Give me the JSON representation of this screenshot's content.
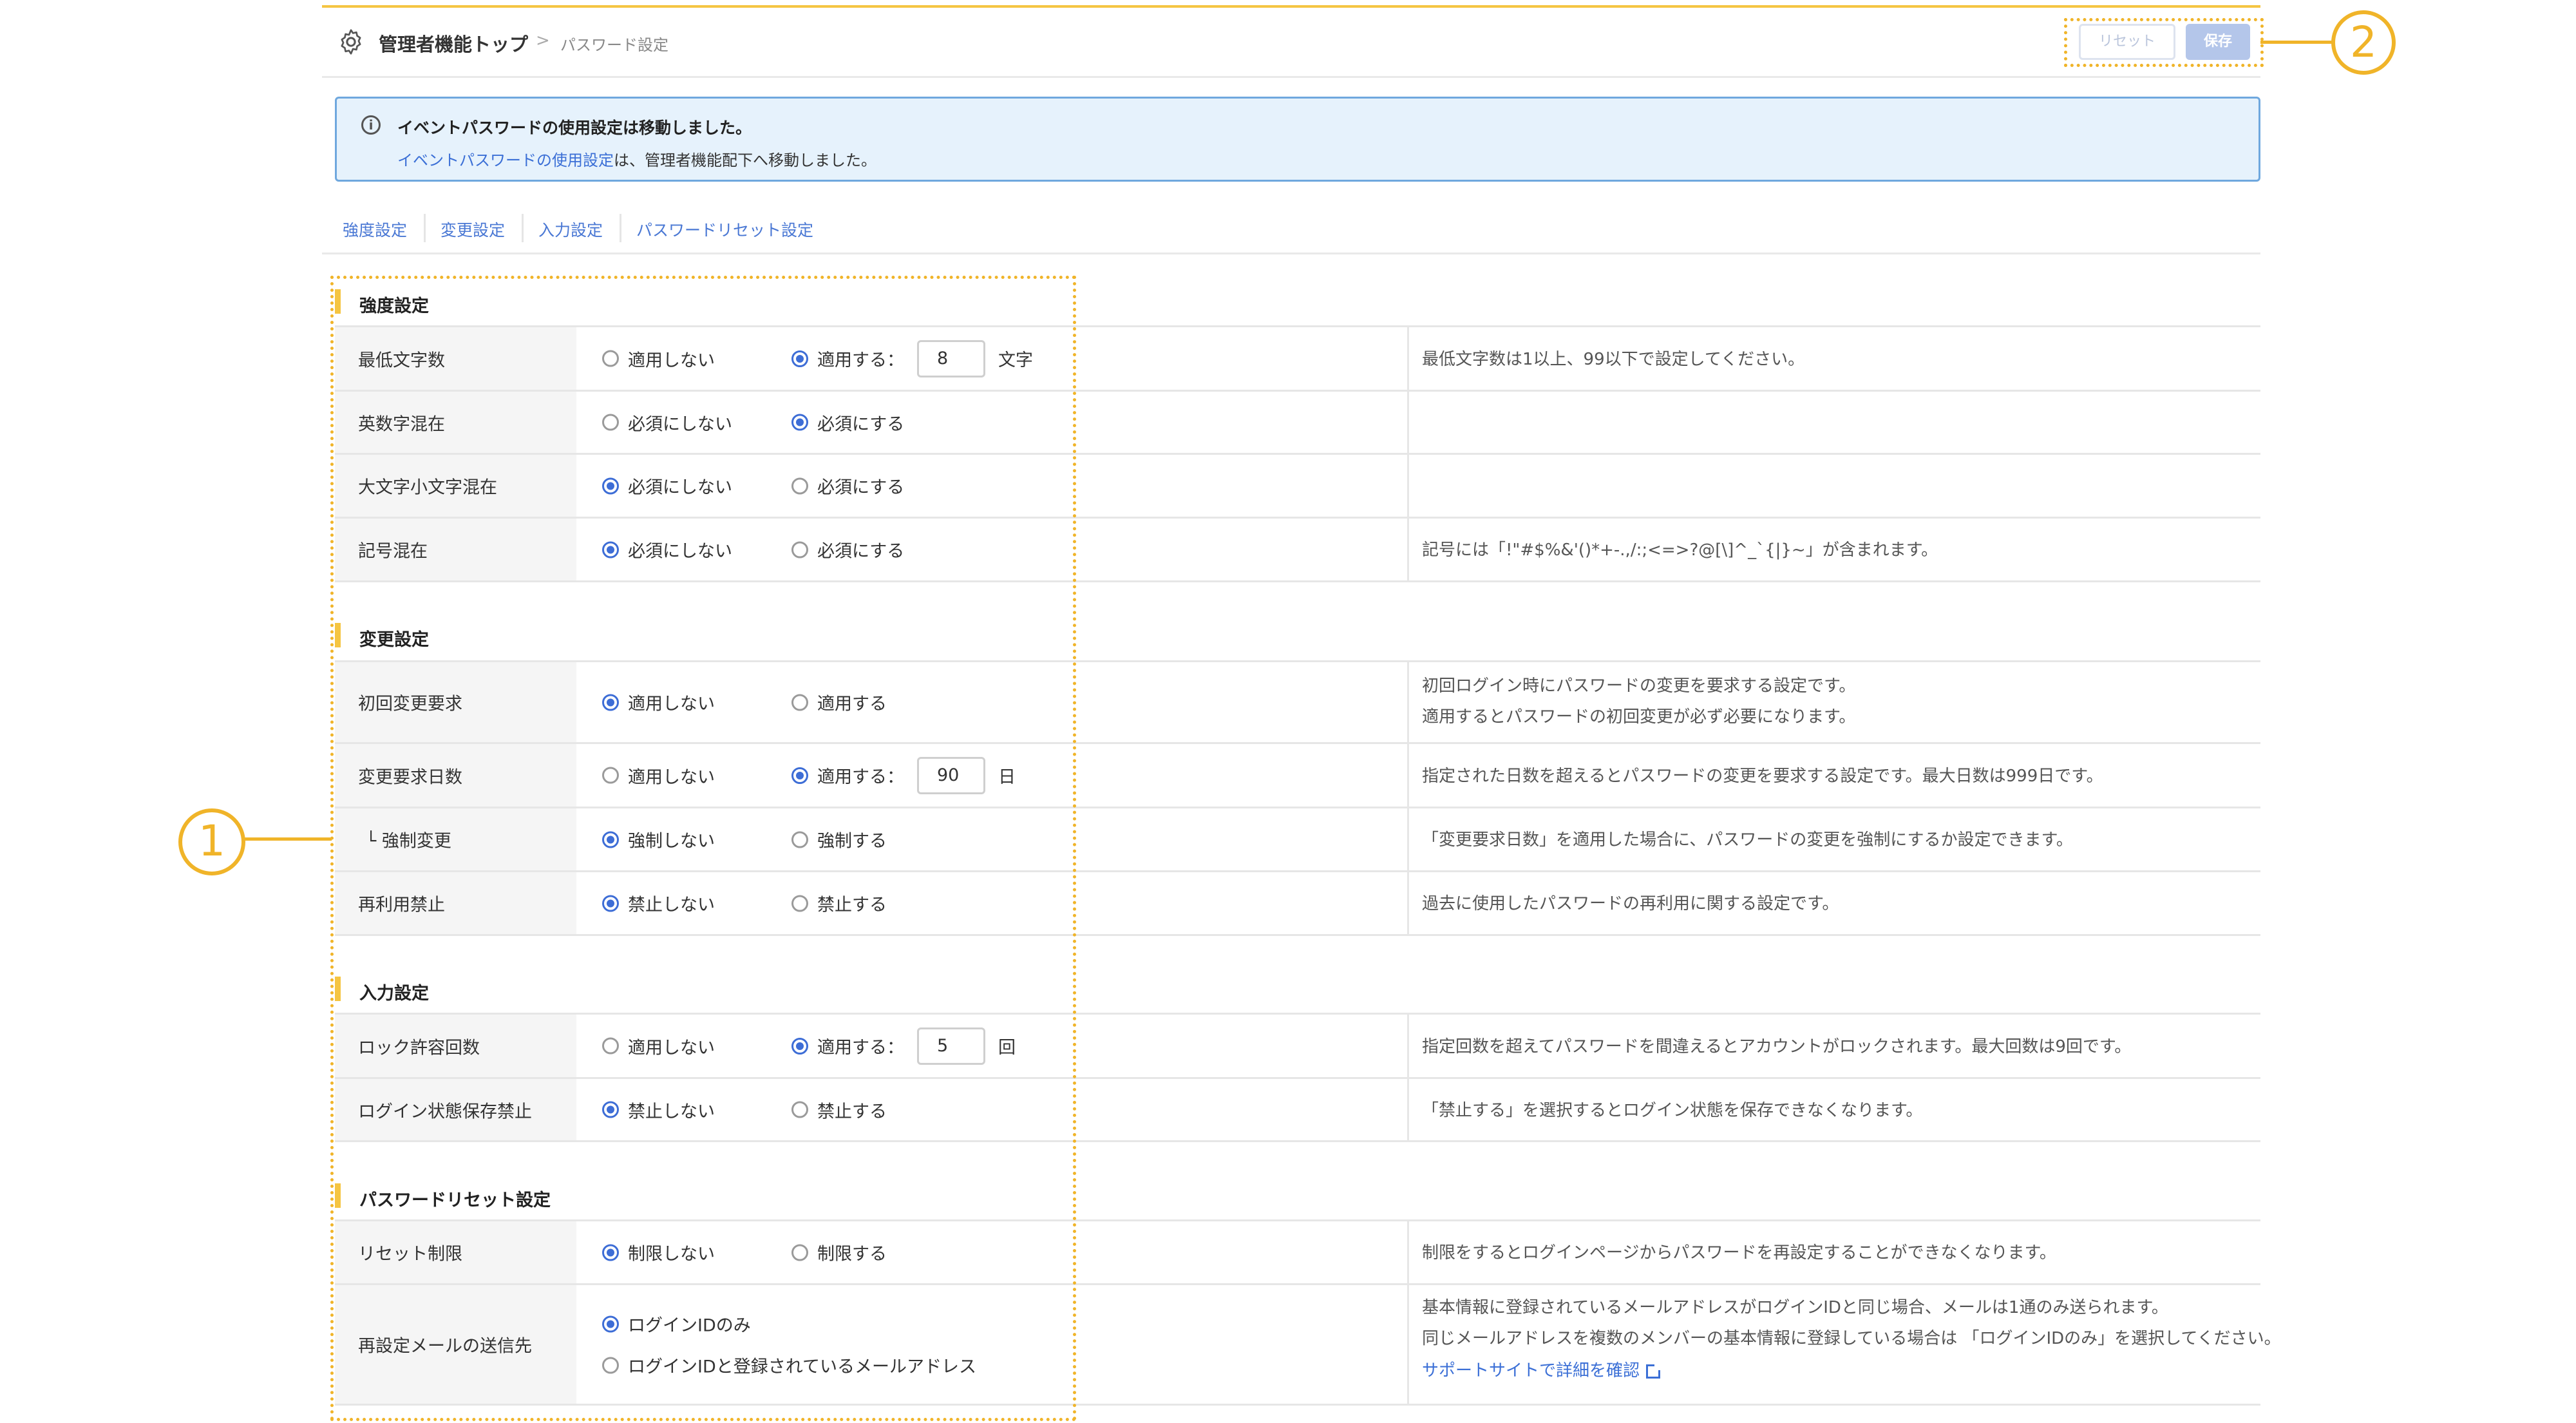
{
  "header": {
    "breadcrumb_home": "管理者機能トップ",
    "breadcrumb_sep": ">",
    "breadcrumb_current": "パスワード設定",
    "reset_label": "リセット",
    "save_label": "保存"
  },
  "annotations": {
    "one": "1",
    "two": "2"
  },
  "info": {
    "title": "イベントパスワードの使用設定は移動しました。",
    "link": "イベントパスワードの使用設定",
    "body": "は、管理者機能配下へ移動しました。"
  },
  "tabs": [
    "強度設定",
    "変更設定",
    "入力設定",
    "パスワードリセット設定"
  ],
  "sections": {
    "strength": {
      "title": "強度設定",
      "min_length": {
        "label": "最低文字数",
        "opt1": "適用しない",
        "opt2": "適用する：",
        "value": "8",
        "unit": "文字",
        "desc": "最低文字数は1以上、99以下で設定してください。"
      },
      "alnum": {
        "label": "英数字混在",
        "opt1": "必須にしない",
        "opt2": "必須にする"
      },
      "case": {
        "label": "大文字小文字混在",
        "opt1": "必須にしない",
        "opt2": "必須にする"
      },
      "symbol": {
        "label": "記号混在",
        "opt1": "必須にしない",
        "opt2": "必須にする",
        "desc": "記号には「!\"#$%&'()*+-.,/:;<=>?@[\\]^_`{|}~」が含まれます。"
      }
    },
    "change": {
      "title": "変更設定",
      "first_change": {
        "label": "初回変更要求",
        "opt1": "適用しない",
        "opt2": "適用する",
        "desc1": "初回ログイン時にパスワードの変更を要求する設定です。",
        "desc2": "適用するとパスワードの初回変更が必ず必要になります。"
      },
      "change_days": {
        "label": "変更要求日数",
        "opt1": "適用しない",
        "opt2": "適用する：",
        "value": "90",
        "unit": "日",
        "desc": "指定された日数を超えるとパスワードの変更を要求する設定です。最大日数は999日です。"
      },
      "force_change": {
        "label": "└ 強制変更",
        "opt1": "強制しない",
        "opt2": "強制する",
        "desc": "「変更要求日数」を適用した場合に、パスワードの変更を強制にするか設定できます。"
      },
      "reuse": {
        "label": "再利用禁止",
        "opt1": "禁止しない",
        "opt2": "禁止する",
        "desc": "過去に使用したパスワードの再利用に関する設定です。"
      }
    },
    "input": {
      "title": "入力設定",
      "lock": {
        "label": "ロック許容回数",
        "opt1": "適用しない",
        "opt2": "適用する：",
        "value": "5",
        "unit": "回",
        "desc": "指定回数を超えてパスワードを間違えるとアカウントがロックされます。最大回数は9回です。"
      },
      "save_login": {
        "label": "ログイン状態保存禁止",
        "opt1": "禁止しない",
        "opt2": "禁止する",
        "desc": "「禁止する」を選択するとログイン状態を保存できなくなります。"
      }
    },
    "reset": {
      "title": "パスワードリセット設定",
      "limit": {
        "label": "リセット制限",
        "opt1": "制限しない",
        "opt2": "制限する",
        "desc": "制限をするとログインページからパスワードを再設定することができなくなります。"
      },
      "mail": {
        "label": "再設定メールの送信先",
        "opt1": "ログインIDのみ",
        "opt2": "ログインIDと登録されているメールアドレス",
        "desc1": "基本情報に登録されているメールアドレスがログインIDと同じ場合、メールは1通のみ送られます。",
        "desc2": "同じメールアドレスを複数のメンバーの基本情報に登録している場合は 「ログインIDのみ」を選択してください。",
        "link": "サポートサイトで詳細を確認"
      }
    }
  },
  "colors": {
    "accent": "#3d6dd6",
    "annotation": "#f0b429",
    "section_bar": "#f5c542",
    "info_bg": "#e6f2fc"
  },
  "icons": [
    "gear-icon",
    "info-icon",
    "external-link-icon"
  ]
}
